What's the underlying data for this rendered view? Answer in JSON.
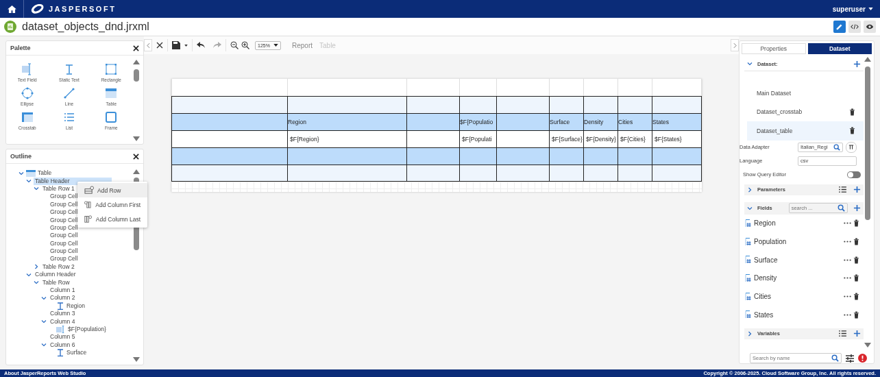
{
  "topbar": {
    "logo": "JASPERSOFT",
    "user": "superuser"
  },
  "titlebar": {
    "title": "dataset_objects_dnd.jrxml",
    "modes": [
      {
        "kind": "design",
        "selected": true
      },
      {
        "kind": "source",
        "selected": false
      },
      {
        "kind": "preview",
        "selected": false
      }
    ]
  },
  "palette": {
    "title": "Palette",
    "items": [
      {
        "label": "Text Field",
        "kind": "textfield"
      },
      {
        "label": "Static Text",
        "kind": "statictext"
      },
      {
        "label": "Rectangle",
        "kind": "rectangle"
      },
      {
        "label": "Ellipse",
        "kind": "ellipse"
      },
      {
        "label": "Line",
        "kind": "line"
      },
      {
        "label": "Table",
        "kind": "table"
      },
      {
        "label": "Crosstab",
        "kind": "crosstab"
      },
      {
        "label": "List",
        "kind": "list"
      },
      {
        "label": "Frame",
        "kind": "frame"
      }
    ]
  },
  "outline": {
    "title": "Outline",
    "tree": [
      {
        "label": "Table",
        "kind": "table",
        "expanded": true,
        "selected": false,
        "children": [
          {
            "label": "Table Header",
            "expanded": true,
            "selected": true,
            "children": [
              {
                "label": "Table Row 1",
                "expanded": true,
                "selected": false,
                "children": [
                  {
                    "label": "Group Cell",
                    "selected": false
                  },
                  {
                    "label": "Group Cell",
                    "selected": false
                  },
                  {
                    "label": "Group Cell",
                    "selected": false
                  },
                  {
                    "label": "Group Cell",
                    "selected": false
                  },
                  {
                    "label": "Group Cell",
                    "selected": false
                  },
                  {
                    "label": "Group Cell",
                    "selected": false
                  },
                  {
                    "label": "Group Cell",
                    "selected": false
                  },
                  {
                    "label": "Group Cell",
                    "selected": false
                  },
                  {
                    "label": "Group Cell",
                    "selected": false
                  }
                ]
              },
              {
                "label": "Table Row 2",
                "expanded": false,
                "selected": false
              }
            ]
          },
          {
            "label": "Column Header",
            "expanded": true,
            "selected": false,
            "children": [
              {
                "label": "Table Row",
                "expanded": true,
                "selected": false,
                "children": [
                  {
                    "label": "Column 1",
                    "selected": false
                  },
                  {
                    "label": "Column 2",
                    "expanded": true,
                    "selected": false,
                    "children": [
                      {
                        "label": "Region",
                        "kind": "statictext",
                        "selected": false
                      }
                    ]
                  },
                  {
                    "label": "Column 3",
                    "selected": false
                  },
                  {
                    "label": "Column 4",
                    "expanded": true,
                    "selected": false,
                    "children": [
                      {
                        "label": "$F{Population}",
                        "kind": "textfield",
                        "selected": false
                      }
                    ]
                  },
                  {
                    "label": "Column 5",
                    "selected": false
                  },
                  {
                    "label": "Column 6",
                    "expanded": true,
                    "selected": false,
                    "children": [
                      {
                        "label": "Surface",
                        "kind": "statictext",
                        "selected": false
                      }
                    ]
                  }
                ]
              }
            ]
          }
        ]
      }
    ]
  },
  "context_menu": [
    {
      "label": "Add Row",
      "kind": "row",
      "selected": true
    },
    {
      "label": "Add Column First",
      "kind": "first",
      "selected": false
    },
    {
      "label": "Add Column Last",
      "kind": "last",
      "selected": false
    }
  ],
  "toolbar": {
    "zoom": "125%",
    "breadcrumbs": [
      {
        "label": "Report",
        "disabled": false
      },
      {
        "label": "Table",
        "disabled": true
      }
    ]
  },
  "report_table": {
    "rows": [
      {
        "kind": "blank",
        "cells": [
          {},
          {},
          {},
          {},
          {},
          {},
          {},
          {},
          {}
        ]
      },
      {
        "kind": "shaded",
        "cells": [
          {},
          {},
          {},
          {},
          {},
          {},
          {},
          {},
          {}
        ]
      },
      {
        "kind": "band",
        "cells": [
          {},
          {
            "text": "Region"
          },
          {},
          {
            "text": "$F{Populatio"
          },
          {},
          {
            "text": "Surface"
          },
          {
            "text": "Density"
          },
          {
            "text": "Cities"
          },
          {
            "text": "States"
          }
        ]
      },
      {
        "kind": "detail",
        "cells": [
          {},
          {
            "text": "$F{Region}"
          },
          {},
          {
            "text": "$F{Populati"
          },
          {},
          {
            "text": "$F{Surface}"
          },
          {
            "text": "$F{Density}"
          },
          {
            "text": "$F{Cities}"
          },
          {
            "text": "$F{States}"
          }
        ]
      },
      {
        "kind": "band",
        "cells": [
          {},
          {},
          {},
          {},
          {},
          {},
          {},
          {},
          {}
        ]
      },
      {
        "kind": "shaded",
        "cells": [
          {},
          {},
          {},
          {},
          {},
          {},
          {},
          {},
          {}
        ]
      }
    ]
  },
  "right_panel": {
    "tabs": [
      {
        "label": "Properties",
        "selected": false
      },
      {
        "label": "Dataset",
        "selected": true
      }
    ],
    "dataset_section": {
      "title": "Dataset:",
      "expanded": true
    },
    "datasets": [
      {
        "label": "Main Dataset",
        "deletable": false,
        "selected": false
      },
      {
        "label": "Dataset_crosstab",
        "deletable": true,
        "selected": false
      },
      {
        "label": "Dataset_table",
        "deletable": true,
        "selected": true
      }
    ],
    "data_adapter": {
      "label": "Data Adapter",
      "value": "Italian_Regi"
    },
    "language": {
      "label": "Language",
      "value": "csv"
    },
    "query_editor": {
      "label": "Show Query Editor",
      "on": false
    },
    "parameters": {
      "title": "Parameters",
      "expanded": false
    },
    "fields_section": {
      "title": "Fields",
      "expanded": true,
      "placeholder": "search ..."
    },
    "fields": [
      "Region",
      "Population",
      "Surface",
      "Density",
      "Cities",
      "States"
    ],
    "variables": {
      "title": "Variables",
      "expanded": false
    },
    "search": {
      "placeholder": "Search by name"
    }
  },
  "footer": {
    "about": "About JasperReports Web Studio",
    "copyright": "Copyright © 2006-2025. Cloud Software Group, Inc. All rights reserved."
  }
}
